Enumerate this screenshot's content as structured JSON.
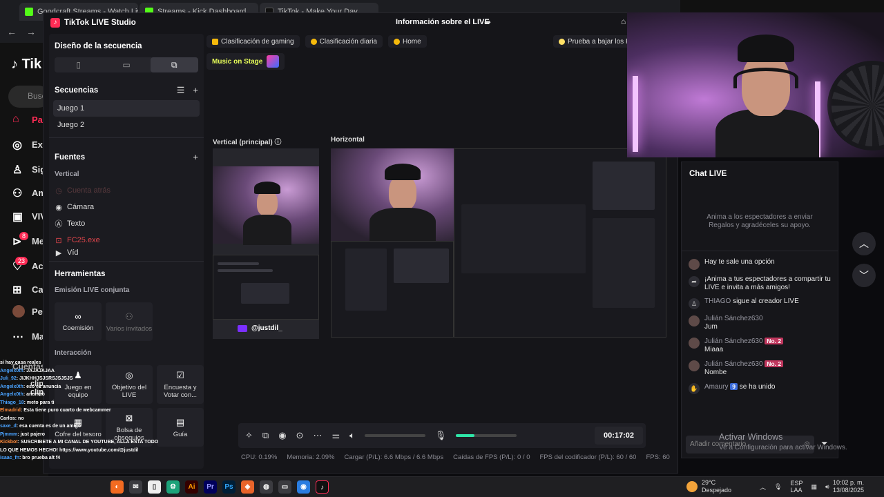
{
  "browser": {
    "tabs": [
      "Goodcraft Streams - Watch Live...",
      "Streams - Kick Dashboard",
      "TikTok - Make Your Day"
    ]
  },
  "tiktok_site": {
    "logo": "Tik",
    "search_placeholder": "Busc",
    "nav": [
      "Pa",
      "Ex",
      "Sig",
      "Am",
      "VIV",
      "Me",
      "Ac",
      "Ca",
      "Pe",
      "Ma"
    ],
    "badges": {
      "messages": "8",
      "activity": "23"
    },
    "accounts_label": "Cuentas",
    "account_items": [
      "clip",
      "clip"
    ]
  },
  "studio": {
    "app_title": "TikTok LIVE Studio",
    "live_info": "Información sobre el LIVE",
    "sequence_design": "Diseño de la secuencia",
    "sequences": {
      "title": "Secuencias",
      "items": [
        "Juego 1",
        "Juego 2"
      ]
    },
    "sources": {
      "title": "Fuentes",
      "section": "Vertical",
      "items": [
        {
          "label": "Cuenta atrás",
          "icon": "countdown-icon",
          "state": "dim"
        },
        {
          "label": "Cámara",
          "icon": "camera-icon",
          "state": "normal"
        },
        {
          "label": "Texto",
          "icon": "text-icon",
          "state": "normal"
        },
        {
          "label": "FC25.exe",
          "icon": "game-capture-icon",
          "state": "error"
        },
        {
          "label": "Víd",
          "icon": "video-icon",
          "state": "normal"
        }
      ]
    },
    "tools": {
      "title": "Herramientas",
      "co_live_title": "Emisión LIVE conjunta",
      "co_live": [
        {
          "label": "Coemisión",
          "icon": "coemission-icon",
          "enabled": true
        },
        {
          "label": "Varios invitados",
          "icon": "multi-guest-icon",
          "enabled": false
        }
      ],
      "interaction_title": "Interacción",
      "interaction": [
        {
          "label": "Juego en equipo",
          "icon": "team-game-icon"
        },
        {
          "label": "Objetivo del LIVE",
          "icon": "target-icon"
        },
        {
          "label": "Encuesta y Votar con...",
          "icon": "poll-icon"
        },
        {
          "label": "Cofre del tesoro",
          "icon": "treasure-icon"
        },
        {
          "label": "Bolsa de obsequios",
          "icon": "gift-bag-icon"
        },
        {
          "label": "Guía",
          "icon": "guide-icon"
        }
      ]
    },
    "pills": [
      "Clasificación de gaming",
      "Clasificación diaria",
      "Home"
    ],
    "pill_right": "Prueba a bajar los FI",
    "music_on_stage": "Music on Stage",
    "vertical_label": "Vertical (principal)",
    "horizontal_label": "Horizontal",
    "preview_username": "@justdil_",
    "timer": "00:17:02",
    "stats": {
      "cpu": "CPU: 0.19%",
      "memory": "Memoria: 2.09%",
      "load": "Cargar (P/L): 6.6 Mbps / 6.6 Mbps",
      "fps_drops": "Caídas de FPS (P/L): 0 / 0",
      "encoder_fps": "FPS del codificador (P/L): 60 / 60",
      "fps": "FPS: 60"
    },
    "mic_level": 0.3
  },
  "chat": {
    "title": "Chat LIVE",
    "empty_hint": "Anima a los espectadores a enviar Regalos y agradéceles su apoyo.",
    "messages": [
      {
        "name": "",
        "text": "Hay te sale una opción",
        "level": "",
        "icon": ""
      },
      {
        "name": "",
        "text": "¡Anima a tus espectadores a compartir tu LIVE e invita a más amigos!",
        "level": "",
        "icon": "share"
      },
      {
        "name": "THIAGO",
        "text": "sigue al creador LIVE",
        "level": "",
        "icon": ""
      },
      {
        "name": "Julián Sánchez630",
        "text": "Jum",
        "level": "",
        "icon": ""
      },
      {
        "name": "Julián Sánchez630",
        "text": "Miaaa",
        "level": "No. 2",
        "icon": ""
      },
      {
        "name": "Julián Sánchez630",
        "text": "Nombe",
        "level": "No. 2",
        "icon": ""
      },
      {
        "name": "Amaury",
        "text": "se ha unido",
        "level": "9",
        "icon": ""
      }
    ],
    "input_placeholder": "Añadir comentario"
  },
  "windows_watermark": {
    "title": "Activar Windows",
    "subtitle": "Ve a Configuración para activar Windows."
  },
  "overlay_chat": [
    {
      "name": "",
      "text": "si hay casa reales"
    },
    {
      "name": "Angelx0th",
      "text": ": JAJAJAJAA"
    },
    {
      "name": "Juli_92",
      "text": ": JIJKHHJSJSRSJSJSJS"
    },
    {
      "name": "Angelx0th",
      "text": ": eso es anuncia"
    },
    {
      "name": "Angelx0th",
      "text": ": anunció"
    },
    {
      "name": "Thiago_18",
      "text": ": meto para ti"
    },
    {
      "name": "Elmadrid",
      "text": ": Esta tiene puro cuarto de webcammer"
    },
    {
      "name": "",
      "text": "Carlos: no"
    },
    {
      "name": "saxe_d",
      "text": ": esa cuenta es de un amigo"
    },
    {
      "name": "Pjmmm",
      "text": ": just pajero"
    },
    {
      "name": "Kickbot",
      "text": ": SUSCRIBETE A MI CANAL DE YOUTUBE, ALLA ESTA TODO LO QUE HEMOS HECHO! https://www.youtube.com/@justdil"
    },
    {
      "name": "isaac_fn",
      "text": ": bro prueba alt f4"
    }
  ],
  "taskbar": {
    "weather_temp": "29°C",
    "weather_desc": "Despejado",
    "lang": "ESP",
    "lang2": "LAA",
    "time": "10:02 p. m.",
    "date": "13/08/2025"
  }
}
